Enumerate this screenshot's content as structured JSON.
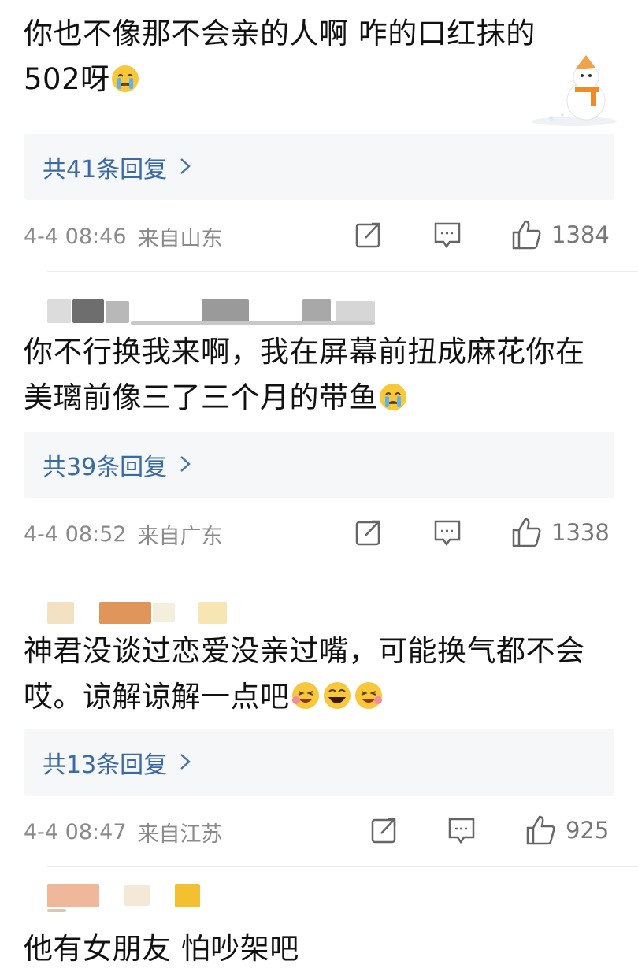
{
  "comments": [
    {
      "text_line1": "你也不像那不会亲的人啊 咋的口红抹的",
      "text_line2": "502呀",
      "replies_label": "共41条回复",
      "time": "4-4 08:46",
      "location": "来自山东",
      "likes": "1384"
    },
    {
      "text_line1": "你不行换我来啊，我在屏幕前扭成麻花你在",
      "text_line2": "美璃前像三了三个月的带鱼",
      "replies_label": "共39条回复",
      "time": "4-4 08:52",
      "location": "来自广东",
      "likes": "1338"
    },
    {
      "text_line1": "神君没谈过恋爱没亲过嘴，可能换气都不会",
      "text_line2": "哎。谅解谅解一点吧",
      "replies_label": "共13条回复",
      "time": "4-4 08:47",
      "location": "来自江苏",
      "likes": "925"
    },
    {
      "text_line1": "他有女朋友 怕吵架吧"
    }
  ],
  "icons": {
    "share": "share-icon",
    "comment": "comment-icon",
    "like": "thumbs-up-icon",
    "chevron": "chevron-right-icon",
    "crying": "crying-emoji-icon",
    "laughing": "laughing-emoji-icon"
  },
  "colors": {
    "reply_link": "#3a6aa6",
    "meta_text": "#8a8a8a",
    "reply_bg": "#f6f7f9",
    "emoji_yellow": "#f7c83c"
  }
}
